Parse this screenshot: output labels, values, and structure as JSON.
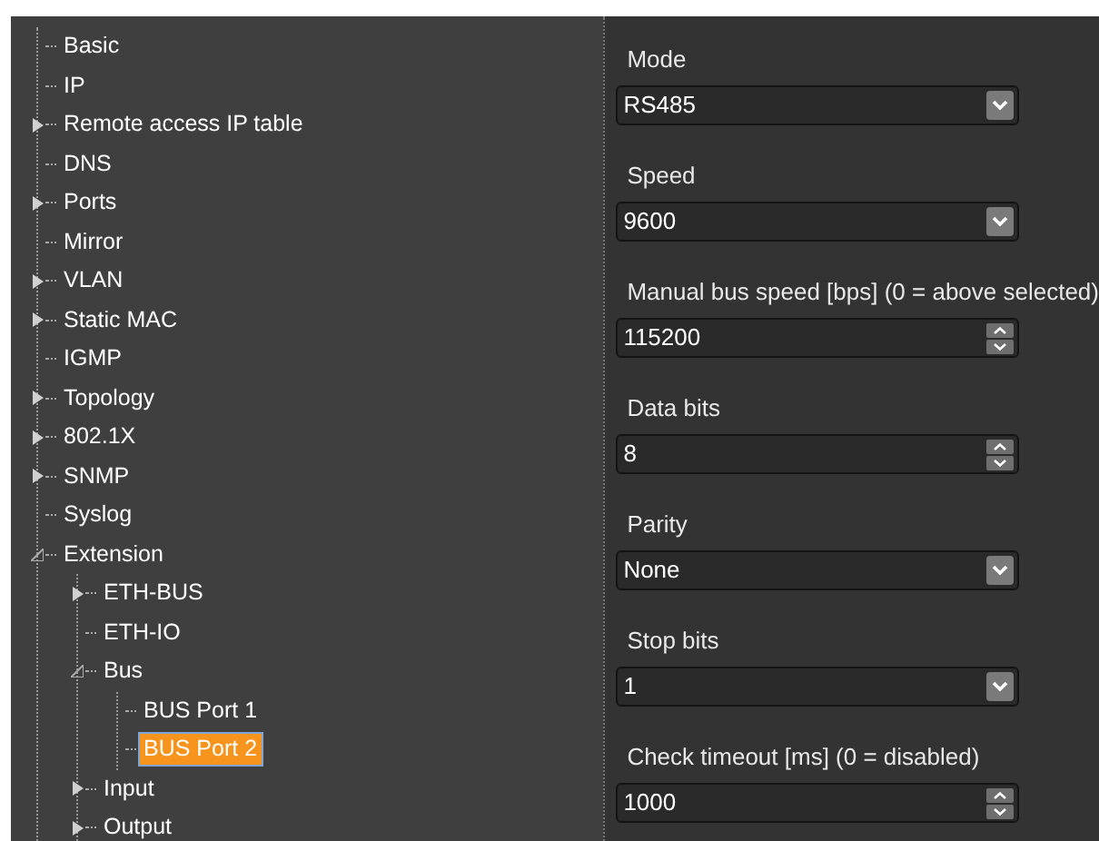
{
  "tree": [
    {
      "label": "Basic",
      "selected": false
    },
    {
      "label": "IP",
      "selected": false
    },
    {
      "label": "Remote access IP table",
      "expanded": false,
      "selected": false
    },
    {
      "label": "DNS",
      "selected": false
    },
    {
      "label": "Ports",
      "expanded": false,
      "selected": false
    },
    {
      "label": "Mirror",
      "selected": false
    },
    {
      "label": "VLAN",
      "expanded": false,
      "selected": false
    },
    {
      "label": "Static MAC",
      "expanded": false,
      "selected": false
    },
    {
      "label": "IGMP",
      "selected": false
    },
    {
      "label": "Topology",
      "expanded": false,
      "selected": false
    },
    {
      "label": "802.1X",
      "expanded": false,
      "selected": false
    },
    {
      "label": "SNMP",
      "expanded": false,
      "selected": false
    },
    {
      "label": "Syslog",
      "selected": false
    },
    {
      "label": "Extension",
      "expanded": true,
      "selected": false,
      "children": [
        {
          "label": "ETH-BUS",
          "expanded": false,
          "selected": false
        },
        {
          "label": "ETH-IO",
          "selected": false
        },
        {
          "label": "Bus",
          "expanded": true,
          "selected": false,
          "children": [
            {
              "label": "BUS Port 1",
              "selected": false
            },
            {
              "label": "BUS Port 2",
              "selected": true
            }
          ]
        },
        {
          "label": "Input",
          "expanded": false,
          "selected": false
        },
        {
          "label": "Output",
          "expanded": false,
          "selected": false
        }
      ]
    }
  ],
  "settings": [
    {
      "label": "Mode",
      "kind": "dropdown",
      "value": "RS485"
    },
    {
      "label": "Speed",
      "kind": "dropdown",
      "value": "9600"
    },
    {
      "label": "Manual bus speed [bps] (0 = above selected)",
      "kind": "spinner",
      "value": "115200"
    },
    {
      "label": "Data bits",
      "kind": "spinner",
      "value": "8"
    },
    {
      "label": "Parity",
      "kind": "dropdown",
      "value": "None"
    },
    {
      "label": "Stop bits",
      "kind": "dropdown",
      "value": "1"
    },
    {
      "label": "Check timeout [ms] (0 = disabled)",
      "kind": "spinner",
      "value": "1000"
    }
  ]
}
